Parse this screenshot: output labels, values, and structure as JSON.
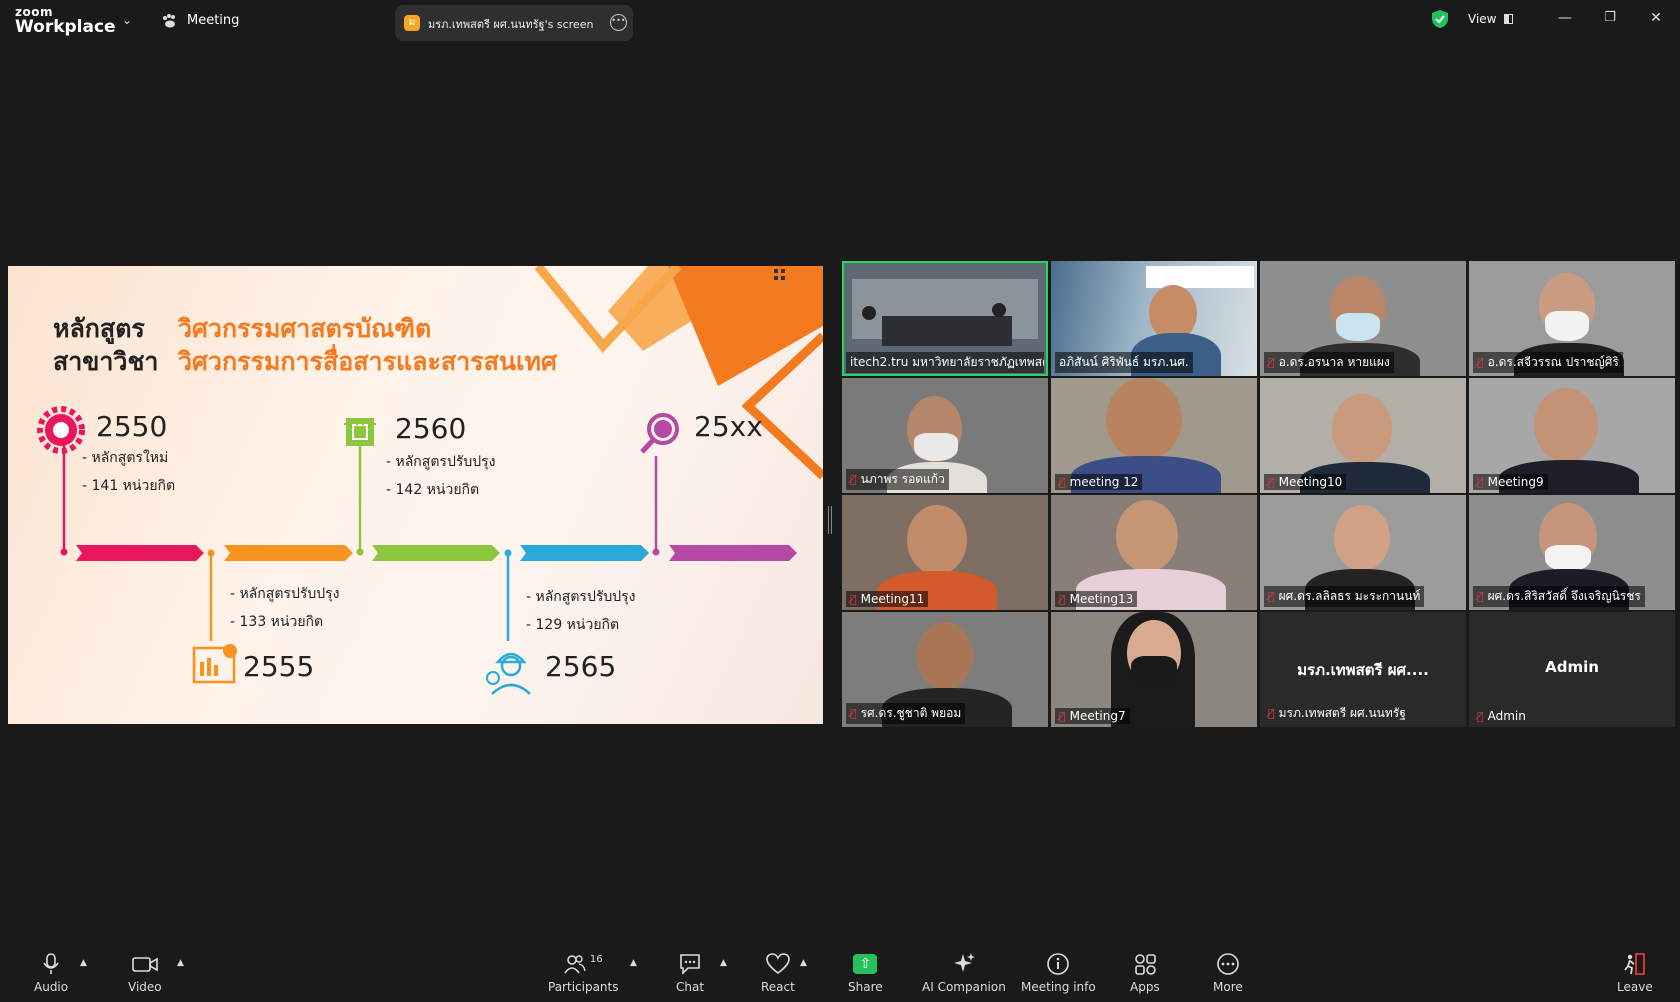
{
  "app": {
    "logo_top": "zoom",
    "logo_bottom": "Workplace",
    "meeting_label": "Meeting"
  },
  "share_banner": {
    "badge": "ม",
    "text": "มรภ.เทพสตรี ผศ.นนทรัฐ's screen"
  },
  "top_right": {
    "view_label": "View"
  },
  "slide": {
    "title_left_1": "หลักสูตร",
    "title_left_2": "สาขาวิชา",
    "title_right_1": "วิศวกรรมศาสตรบัณฑิต",
    "title_right_2": "วิศวกรรมการสื่อสารและสารสนเทศ",
    "milestones": [
      {
        "year": "2550",
        "line1": "- หลักสูตรใหม่",
        "line2": "- 141 หน่วยกิต"
      },
      {
        "year": "2555",
        "line1": "- หลักสูตรปรับปรุง",
        "line2": "- 133 หน่วยกิต"
      },
      {
        "year": "2560",
        "line1": "- หลักสูตรปรับปรุง",
        "line2": "- 142 หน่วยกิต"
      },
      {
        "year": "2565",
        "line1": "- หลักสูตรปรับปรุง",
        "line2": "- 129 หน่วยกิต"
      },
      {
        "year": "25xx",
        "line1": "",
        "line2": ""
      }
    ],
    "colors": {
      "accent": "#f47a20",
      "pink": "#e8175d",
      "green": "#8dc63f",
      "blue": "#29aad9",
      "purple": "#b44aa6",
      "orange": "#f7941d"
    }
  },
  "participants": [
    {
      "name": "itech2.tru มหาวิทยาลัยราชภัฏเทพสตรี",
      "muted": false,
      "active": true
    },
    {
      "name": "อภิสันน์  ศิริพันธ์ มรภ.นศ.",
      "muted": false,
      "active": false
    },
    {
      "name": "อ.ดร.อรนาล  หายแผง",
      "muted": true,
      "active": false
    },
    {
      "name": "อ.ดร.สจีวรรณ  ปราชญ์ศิริ",
      "muted": true,
      "active": false
    },
    {
      "name": "นภาพร รอดแก้ว",
      "muted": true,
      "active": false
    },
    {
      "name": "meeting 12",
      "muted": true,
      "active": false
    },
    {
      "name": "Meeting10",
      "muted": true,
      "active": false
    },
    {
      "name": "Meeting9",
      "muted": true,
      "active": false
    },
    {
      "name": "Meeting11",
      "muted": true,
      "active": false
    },
    {
      "name": "Meeting13",
      "muted": true,
      "active": false
    },
    {
      "name": "ผศ.ดร.ลลิลธร มะระกานนท์",
      "muted": true,
      "active": false
    },
    {
      "name": "ผศ.ดร.สิริสวัสดิ์ จึงเจริญนิรชร",
      "muted": true,
      "active": false
    },
    {
      "name": "รศ.ดร.ชูชาติ  พยอม",
      "muted": true,
      "active": false
    },
    {
      "name": "Meeting7",
      "muted": true,
      "active": false
    },
    {
      "name": "มรภ.เทพสตรี ผศ.นนทรัฐ",
      "muted": true,
      "active": false,
      "display_name": "มรภ.เทพสตรี ผศ...."
    },
    {
      "name": "Admin",
      "muted": true,
      "active": false,
      "display_name": "Admin"
    }
  ],
  "toolbar": {
    "audio": "Audio",
    "video": "Video",
    "participants": "Participants",
    "participants_count": "16",
    "chat": "Chat",
    "react": "React",
    "share": "Share",
    "ai_companion": "AI Companion",
    "meeting_info": "Meeting info",
    "apps": "Apps",
    "more": "More",
    "leave": "Leave"
  }
}
